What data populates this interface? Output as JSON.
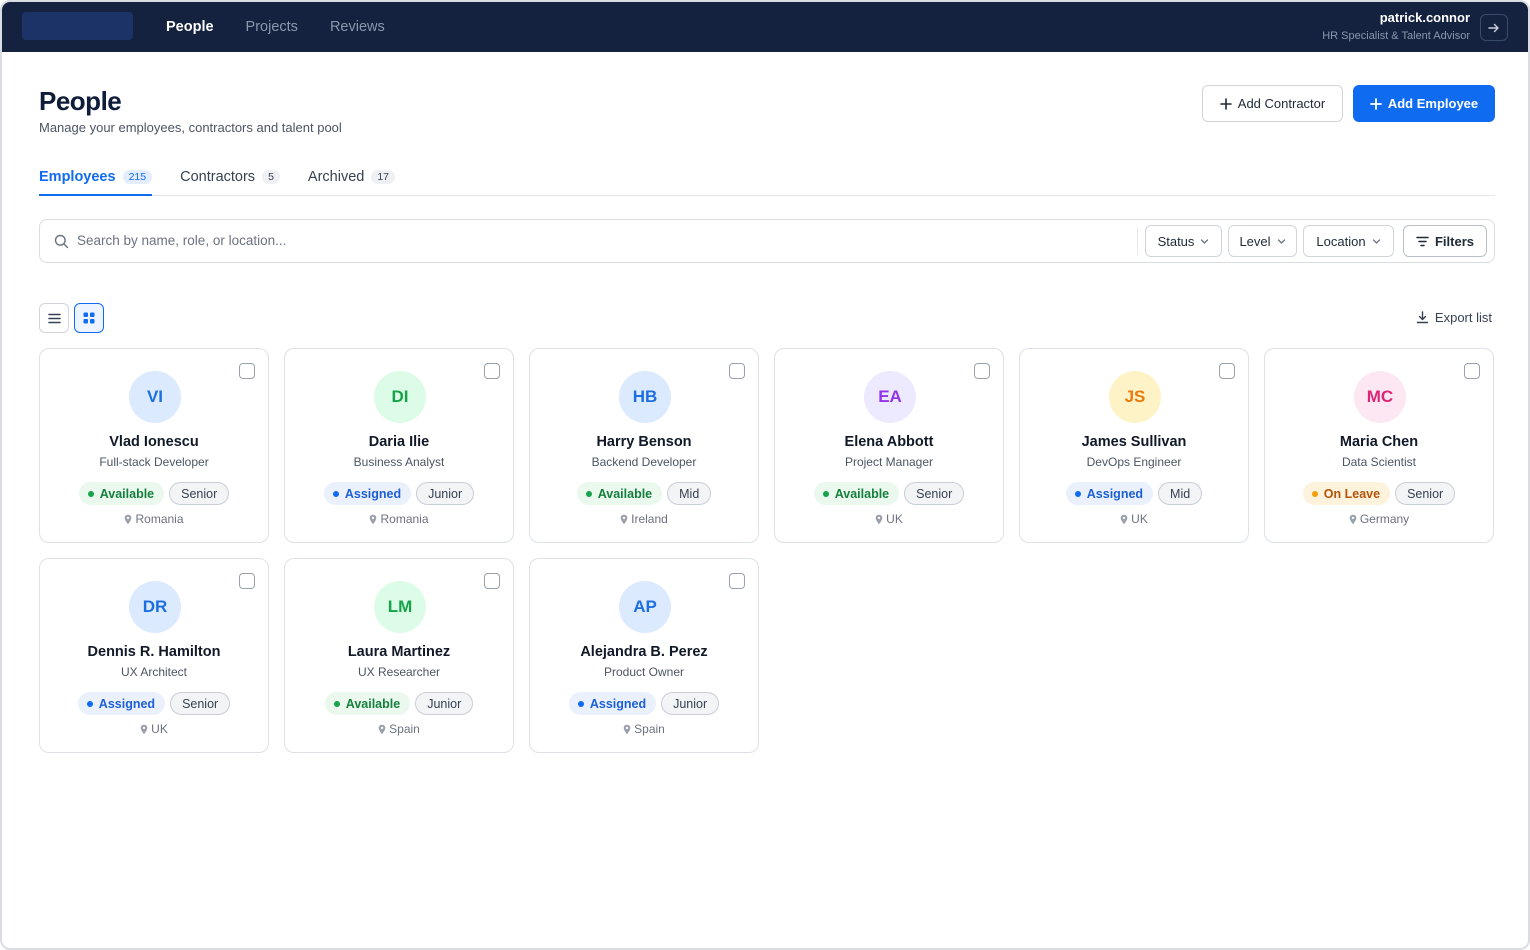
{
  "nav": {
    "items": [
      {
        "label": "People",
        "active": true
      },
      {
        "label": "Projects",
        "active": false
      },
      {
        "label": "Reviews",
        "active": false
      }
    ]
  },
  "user": {
    "name": "patrick.connor",
    "role": "HR Specialist & Talent Advisor"
  },
  "header": {
    "title": "People",
    "subtitle": "Manage your employees, contractors and talent pool",
    "add_contractor_label": "Add Contractor",
    "add_employee_label": "Add Employee"
  },
  "tabs": [
    {
      "label": "Employees",
      "count": "215",
      "active": true
    },
    {
      "label": "Contractors",
      "count": "5",
      "active": false
    },
    {
      "label": "Archived",
      "count": "17",
      "active": false
    }
  ],
  "search": {
    "placeholder": "Search by name, role, or location..."
  },
  "filters": {
    "status_label": "Status",
    "level_label": "Level",
    "location_label": "Location",
    "filters_label": "Filters"
  },
  "toolbar": {
    "export_label": "Export list",
    "view_mode": "grid"
  },
  "colors": {
    "accent": "#0f6cf0",
    "topbar": "#14223f"
  },
  "people": [
    {
      "initials": "VI",
      "name": "Vlad Ionescu",
      "role": "Full-stack Developer",
      "status": "Available",
      "level": "Senior",
      "location": "Romania",
      "avatar_bg": "#dbeafe",
      "avatar_fg": "#1d6fe0"
    },
    {
      "initials": "DI",
      "name": "Daria Ilie",
      "role": "Business Analyst",
      "status": "Assigned",
      "level": "Junior",
      "location": "Romania",
      "avatar_bg": "#dcfce7",
      "avatar_fg": "#16a34a"
    },
    {
      "initials": "HB",
      "name": "Harry Benson",
      "role": "Backend Developer",
      "status": "Available",
      "level": "Mid",
      "location": "Ireland",
      "avatar_bg": "#dbeafe",
      "avatar_fg": "#1d6fe0"
    },
    {
      "initials": "EA",
      "name": "Elena Abbott",
      "role": "Project Manager",
      "status": "Available",
      "level": "Senior",
      "location": "UK",
      "avatar_bg": "#ede9fe",
      "avatar_fg": "#9333ea"
    },
    {
      "initials": "JS",
      "name": "James Sullivan",
      "role": "DevOps Engineer",
      "status": "Assigned",
      "level": "Mid",
      "location": "UK",
      "avatar_bg": "#fef3c7",
      "avatar_fg": "#ea7a0c"
    },
    {
      "initials": "MC",
      "name": "Maria Chen",
      "role": "Data Scientist",
      "status": "On Leave",
      "level": "Senior",
      "location": "Germany",
      "avatar_bg": "#fce7f3",
      "avatar_fg": "#db2777"
    },
    {
      "initials": "DR",
      "name": "Dennis R. Hamilton",
      "role": "UX Architect",
      "status": "Assigned",
      "level": "Senior",
      "location": "UK",
      "avatar_bg": "#dbeafe",
      "avatar_fg": "#1d6fe0"
    },
    {
      "initials": "LM",
      "name": "Laura Martinez",
      "role": "UX Researcher",
      "status": "Available",
      "level": "Junior",
      "location": "Spain",
      "avatar_bg": "#dcfce7",
      "avatar_fg": "#16a34a"
    },
    {
      "initials": "AP",
      "name": "Alejandra B. Perez",
      "role": "Product Owner",
      "status": "Assigned",
      "level": "Junior",
      "location": "Spain",
      "avatar_bg": "#dbeafe",
      "avatar_fg": "#1d6fe0"
    }
  ]
}
